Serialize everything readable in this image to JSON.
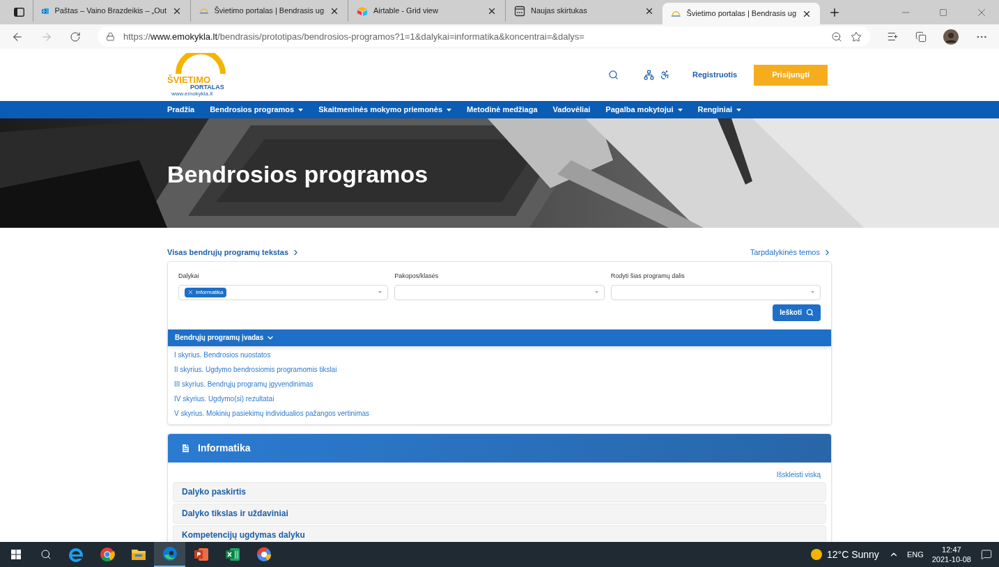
{
  "browser": {
    "tabs": [
      {
        "kind": "mail",
        "title": "Paštas – Vaino Brazdeikis – „Out",
        "selected": false
      },
      {
        "kind": "portal",
        "title": "Švietimo portalas | Bendrasis ug",
        "selected": false
      },
      {
        "kind": "airtable",
        "title": "Airtable - Grid view",
        "selected": false
      },
      {
        "kind": "newtab",
        "title": "Naujas skirtukas",
        "selected": false
      },
      {
        "kind": "portal",
        "title": "Švietimo portalas | Bendrasis ug",
        "selected": true
      }
    ],
    "url": {
      "scheme": "https://",
      "host": "www.emokykla.lt",
      "path": "/bendrasis/prototipas/bendrosios-programos?1=1&dalykai=informatika&koncentrai=&dalys="
    }
  },
  "site": {
    "logo": {
      "title": "ŠVIETIMO",
      "subtitle": "PORTALAS",
      "domain": "www.emokykla.lt"
    },
    "register": "Registruotis",
    "login": "Prisijungti",
    "nav": [
      {
        "label": "Pradžia",
        "dropdown": false
      },
      {
        "label": "Bendrosios programos",
        "dropdown": true
      },
      {
        "label": "Skaitmeninės mokymo priemonės",
        "dropdown": true
      },
      {
        "label": "Metodinė medžiaga",
        "dropdown": false
      },
      {
        "label": "Vadovėliai",
        "dropdown": false
      },
      {
        "label": "Pagalba mokytojui",
        "dropdown": true
      },
      {
        "label": "Renginiai",
        "dropdown": true
      }
    ],
    "hero_title": "Bendrosios programos",
    "full_text_link": "Visas bendrųjų programų tekstas",
    "topics_link": "Tarpdalykinės temos",
    "filters": [
      {
        "label": "Dalykai",
        "chips": [
          "Informatika"
        ]
      },
      {
        "label": "Pakopos/klasės"
      },
      {
        "label": "Rodyti šias programų dalis"
      }
    ],
    "search_button": "Ieškoti",
    "intro": {
      "title": "Bendrųjų programų įvadas",
      "expanded": true,
      "items": [
        "I skyrius. Bendrosios nuostatos",
        "II skyrius. Ugdymo bendrosiomis programomis tikslai",
        "III skyrius. Bendrųjų programų įgyvendinimas",
        "IV skyrius. Ugdymo(si) rezultatai",
        "V skyrius. Mokinių pasiekimų individualios pažangos vertinimas"
      ]
    },
    "subject": {
      "title": "Informatika",
      "expand_all": "Išskleisti viską",
      "sections": [
        "Dalyko paskirtis",
        "Dalyko tikslas ir uždaviniai",
        "Kompetencijų ugdymas dalyku"
      ]
    }
  },
  "taskbar": {
    "apps": [
      {
        "kind": "ie",
        "selected": false
      },
      {
        "kind": "chrome",
        "selected": false
      },
      {
        "kind": "folder",
        "selected": false
      },
      {
        "kind": "edge",
        "selected": true
      },
      {
        "kind": "powerpoint",
        "selected": false
      },
      {
        "kind": "excel",
        "selected": false
      },
      {
        "kind": "chromeapp",
        "selected": false
      }
    ],
    "weather": "12°C Sunny",
    "language": "ENG",
    "time": "12:47",
    "date": "2021-10-08"
  }
}
